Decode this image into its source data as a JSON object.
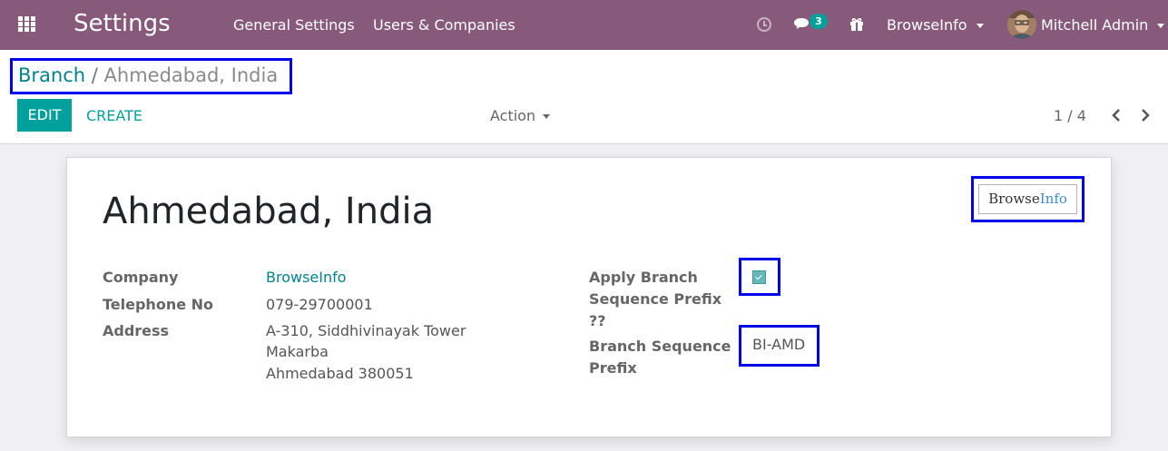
{
  "navbar": {
    "app_title": "Settings",
    "menus": [
      "General Settings",
      "Users & Companies"
    ],
    "chat_count": "3",
    "company": "BrowseInfo",
    "user_name": "Mitchell Admin"
  },
  "breadcrumb": {
    "parent": "Branch",
    "separator": "/",
    "current": "Ahmedabad, India"
  },
  "buttons": {
    "edit": "EDIT",
    "create": "CREATE",
    "action": "Action"
  },
  "pager": {
    "value": "1 / 4"
  },
  "form": {
    "name": "Ahmedabad, India",
    "logo": {
      "part1": "Browse",
      "part2": "Info"
    },
    "left_fields": {
      "company_label": "Company",
      "company_value": "BrowseInfo",
      "telephone_label": "Telephone No",
      "telephone_value": "079-29700001",
      "address_label": "Address",
      "address_lines": [
        "A-310, Siddhivinayak Tower",
        "Makarba",
        "Ahmedabad 380051"
      ]
    },
    "right_fields": {
      "apply_prefix_label_lines": [
        "Apply Branch",
        "Sequence Prefix",
        "??"
      ],
      "apply_prefix_checked": true,
      "prefix_label_lines": [
        "Branch Sequence",
        "Prefix"
      ],
      "prefix_value": "BI-AMD"
    }
  },
  "colors": {
    "navbar": "#875a7b",
    "primary": "#00a09d",
    "link": "#00838a",
    "highlight_border": "#0000e8"
  }
}
